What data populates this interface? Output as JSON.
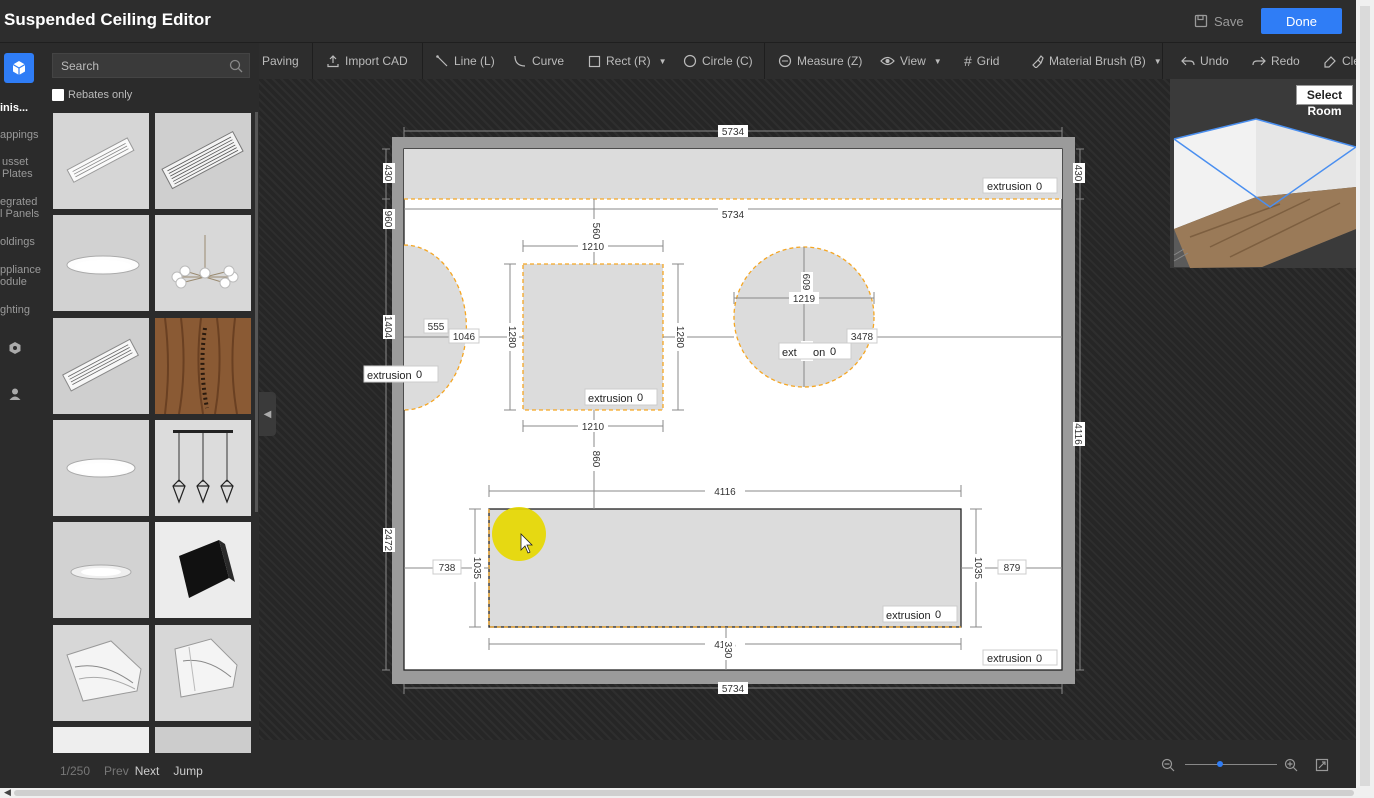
{
  "header": {
    "title": "Suspended Ceiling Editor",
    "save_label": "Save",
    "done_label": "Done"
  },
  "rail": {
    "items": [
      "inis...",
      "appings",
      "usset",
      "Plates",
      "egrated",
      "l Panels",
      "oldings",
      "ppliance",
      "odule",
      "ghting"
    ]
  },
  "catalog": {
    "search_placeholder": "Search",
    "rebates_label": "Rebates only",
    "tiles": [
      "linear-vent-grille",
      "slot-diffuser",
      "round-panel-light",
      "branch-chandelier",
      "wood-grain-panel",
      "linear-vent-grille",
      "round-panel-light",
      "triple-cage-pendant",
      "recessed-downlight",
      "black-wall-light",
      "crown-molding",
      "crown-molding-corner"
    ],
    "pager": {
      "count": "1/250",
      "prev": "Prev",
      "next": "Next",
      "jump": "Jump"
    }
  },
  "toolbar": {
    "paving": "Paving",
    "import_cad": "Import CAD",
    "line": "Line (L)",
    "curve": "Curve",
    "rect": "Rect (R)",
    "circle": "Circle (C)",
    "measure": "Measure (Z)",
    "view": "View",
    "grid": "Grid",
    "material_brush": "Material Brush (B)",
    "undo": "Undo",
    "redo": "Redo",
    "clear": "Cle"
  },
  "preview": {
    "select_line1": "Select",
    "select_line2": "Room"
  },
  "drawing": {
    "extrusion_label": "extrusion",
    "extrusion_value": "0",
    "ext_partial": "ext",
    "on_partial": "on",
    "dims": {
      "room_width": "5734",
      "band_width": "5734",
      "rect_width": "1210",
      "rect_height": "1280",
      "circle_dia": "1219",
      "circle_half": "609",
      "circle_right": "3478",
      "rect_gap_top": "560",
      "left_arc_r": "555",
      "left_arc_x": "1046",
      "rect_gap_bottom": "860",
      "bottom_width": "4116",
      "bottom_height": "1035",
      "bottom_left": "738",
      "bottom_right": "879",
      "left_top": "430",
      "left_band": "960",
      "left_mid": "1404",
      "left_low": "2472",
      "right_top": "430",
      "right_full": "4116",
      "bottom_gap": "330"
    }
  },
  "colors": {
    "accent": "#2f7df6",
    "selection": "#f5a623",
    "cursor_highlight": "#e6d800"
  }
}
